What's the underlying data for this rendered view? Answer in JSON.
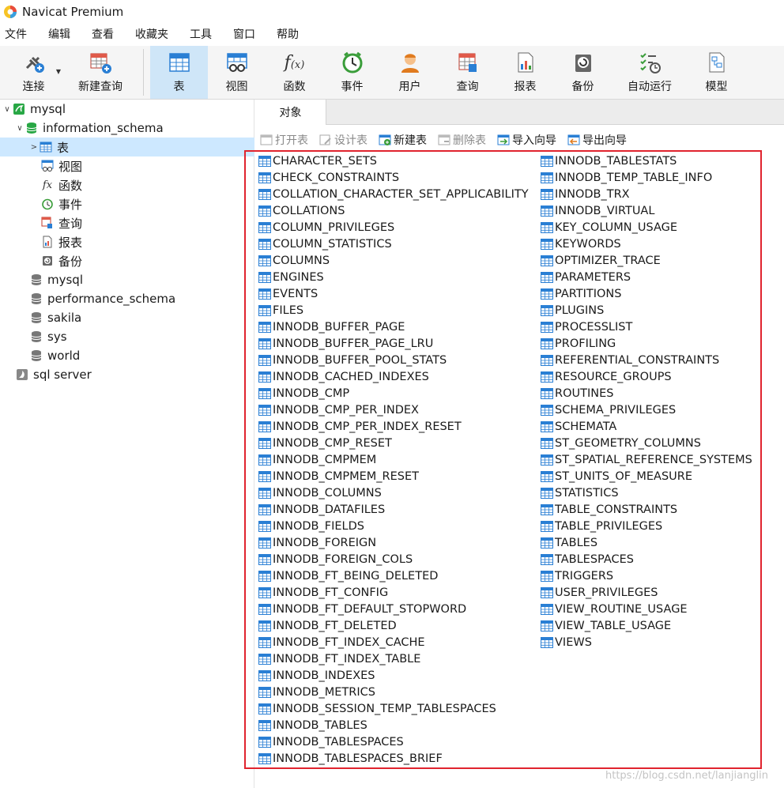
{
  "window": {
    "title": "Navicat Premium"
  },
  "menu": [
    "文件",
    "编辑",
    "查看",
    "收藏夹",
    "工具",
    "窗口",
    "帮助"
  ],
  "toolbar": [
    {
      "label": "连接",
      "icon": "connect-icon"
    },
    {
      "label": "新建查询",
      "icon": "new-query-icon"
    },
    {
      "label": "表",
      "icon": "table-icon",
      "active": true
    },
    {
      "label": "视图",
      "icon": "view-icon"
    },
    {
      "label": "函数",
      "icon": "function-icon"
    },
    {
      "label": "事件",
      "icon": "event-icon"
    },
    {
      "label": "用户",
      "icon": "user-icon"
    },
    {
      "label": "查询",
      "icon": "query-icon"
    },
    {
      "label": "报表",
      "icon": "report-icon"
    },
    {
      "label": "备份",
      "icon": "backup-icon"
    },
    {
      "label": "自动运行",
      "icon": "automation-icon"
    },
    {
      "label": "模型",
      "icon": "model-icon"
    }
  ],
  "sidebar": {
    "tree": [
      {
        "label": "mysql",
        "icon": "mysql-connection-icon",
        "arrow": "v"
      },
      {
        "label": "information_schema",
        "icon": "database-icon",
        "arrow": "v"
      },
      {
        "label": "表",
        "icon": "table-icon",
        "arrow": ">",
        "selected": true
      },
      {
        "label": "视图",
        "icon": "view-icon"
      },
      {
        "label": "函数",
        "icon": "function-icon"
      },
      {
        "label": "事件",
        "icon": "event-icon"
      },
      {
        "label": "查询",
        "icon": "query-icon"
      },
      {
        "label": "报表",
        "icon": "report-icon"
      },
      {
        "label": "备份",
        "icon": "backup-icon"
      },
      {
        "label": "mysql",
        "icon": "database-icon"
      },
      {
        "label": "performance_schema",
        "icon": "database-icon"
      },
      {
        "label": "sakila",
        "icon": "database-icon"
      },
      {
        "label": "sys",
        "icon": "database-icon"
      },
      {
        "label": "world",
        "icon": "database-icon"
      },
      {
        "label": "sql server",
        "icon": "sqlserver-connection-icon"
      }
    ]
  },
  "tabs": {
    "objects": "对象"
  },
  "object_toolbar": [
    {
      "label": "打开表",
      "enabled": false,
      "icon": "open-table-icon"
    },
    {
      "label": "设计表",
      "enabled": false,
      "icon": "design-table-icon"
    },
    {
      "label": "新建表",
      "enabled": true,
      "icon": "new-table-icon"
    },
    {
      "label": "删除表",
      "enabled": false,
      "icon": "delete-table-icon"
    },
    {
      "label": "导入向导",
      "enabled": true,
      "icon": "import-wizard-icon"
    },
    {
      "label": "导出向导",
      "enabled": true,
      "icon": "export-wizard-icon"
    }
  ],
  "tables_col1": [
    "CHARACTER_SETS",
    "CHECK_CONSTRAINTS",
    "COLLATION_CHARACTER_SET_APPLICABILITY",
    "COLLATIONS",
    "COLUMN_PRIVILEGES",
    "COLUMN_STATISTICS",
    "COLUMNS",
    "ENGINES",
    "EVENTS",
    "FILES",
    "INNODB_BUFFER_PAGE",
    "INNODB_BUFFER_PAGE_LRU",
    "INNODB_BUFFER_POOL_STATS",
    "INNODB_CACHED_INDEXES",
    "INNODB_CMP",
    "INNODB_CMP_PER_INDEX",
    "INNODB_CMP_PER_INDEX_RESET",
    "INNODB_CMP_RESET",
    "INNODB_CMPMEM",
    "INNODB_CMPMEM_RESET",
    "INNODB_COLUMNS",
    "INNODB_DATAFILES",
    "INNODB_FIELDS",
    "INNODB_FOREIGN",
    "INNODB_FOREIGN_COLS",
    "INNODB_FT_BEING_DELETED",
    "INNODB_FT_CONFIG",
    "INNODB_FT_DEFAULT_STOPWORD",
    "INNODB_FT_DELETED",
    "INNODB_FT_INDEX_CACHE",
    "INNODB_FT_INDEX_TABLE",
    "INNODB_INDEXES",
    "INNODB_METRICS",
    "INNODB_SESSION_TEMP_TABLESPACES",
    "INNODB_TABLES",
    "INNODB_TABLESPACES",
    "INNODB_TABLESPACES_BRIEF"
  ],
  "tables_col2": [
    "INNODB_TABLESTATS",
    "INNODB_TEMP_TABLE_INFO",
    "INNODB_TRX",
    "INNODB_VIRTUAL",
    "KEY_COLUMN_USAGE",
    "KEYWORDS",
    "OPTIMIZER_TRACE",
    "PARAMETERS",
    "PARTITIONS",
    "PLUGINS",
    "PROCESSLIST",
    "PROFILING",
    "REFERENTIAL_CONSTRAINTS",
    "RESOURCE_GROUPS",
    "ROUTINES",
    "SCHEMA_PRIVILEGES",
    "SCHEMATA",
    "ST_GEOMETRY_COLUMNS",
    "ST_SPATIAL_REFERENCE_SYSTEMS",
    "ST_UNITS_OF_MEASURE",
    "STATISTICS",
    "TABLE_CONSTRAINTS",
    "TABLE_PRIVILEGES",
    "TABLES",
    "TABLESPACES",
    "TRIGGERS",
    "USER_PRIVILEGES",
    "VIEW_ROUTINE_USAGE",
    "VIEW_TABLE_USAGE",
    "VIEWS"
  ],
  "watermark": "https://blog.csdn.net/lanjianglin",
  "colors": {
    "accent": "#2a7fd4",
    "selection": "#cde8ff",
    "highlight_frame": "#e0242e"
  }
}
